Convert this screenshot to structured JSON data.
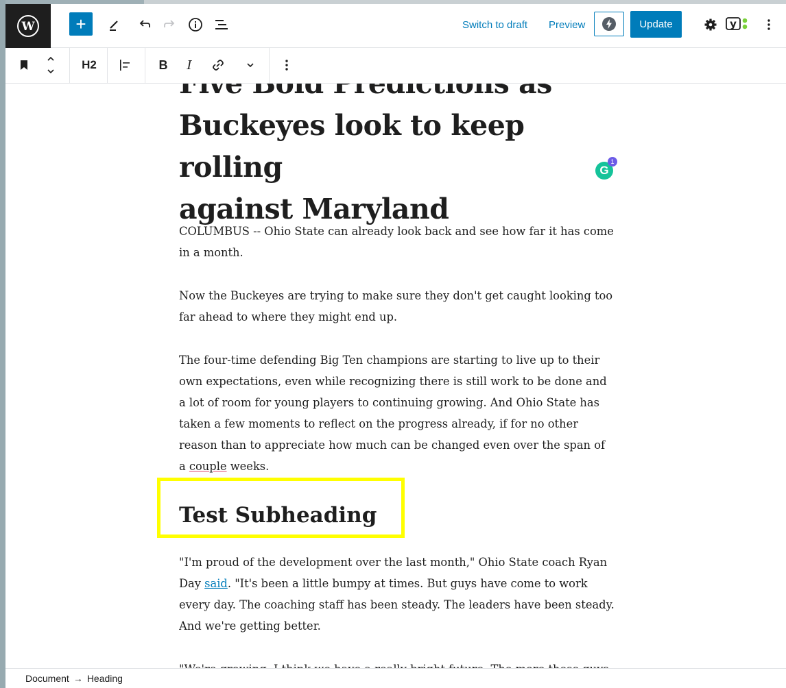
{
  "header": {
    "switch_to_draft": "Switch to draft",
    "preview": "Preview",
    "update": "Update"
  },
  "block_toolbar": {
    "block_type": "H2",
    "bold": "B",
    "italic": "I"
  },
  "post": {
    "title_line1": "Five Bold Predictions as",
    "title_line2": "Buckeyes look to keep rolling",
    "title_line3": "against Maryland",
    "para1_line1": "COLUMBUS -- Ohio State can already look back and see how far it has come",
    "para1_line2": "in a month.",
    "para2_line1": "Now the Buckeyes are trying to make sure they don't get caught looking too",
    "para2_line2": "far ahead to where they might end up.",
    "para3_line1": "The four-time defending Big Ten champions are starting to live up to their",
    "para3_line2": "own expectations, even while recognizing there is still work to be done and",
    "para3_line3": "a lot of room for young players to continuing growing. And Ohio State has",
    "para3_line4": "taken a few moments to reflect on the progress already, if for no other",
    "para3_line5": "reason than to appreciate how much can be changed even over the span of",
    "para3_line6_a": "a ",
    "para3_line6_b": "couple",
    "para3_line6_c": " weeks.",
    "subheading": "Test Subheading",
    "para4_line1": "\"I'm proud of the development over the last month,\" Ohio State coach Ryan",
    "para4_line2_a": "Day ",
    "para4_line2_link": "said",
    "para4_line2_b": ". \"It's been a little bumpy at times. But guys have come to work",
    "para4_line3": "every day. The coaching staff has been steady. The leaders have been steady.",
    "para4_line4": "And we're getting better.",
    "para5_line1": "\"We're growing. I think we have a really bright future. The more these guys"
  },
  "grammarly": {
    "count": "1",
    "letter": "G"
  },
  "breadcrumb": {
    "document": "Document",
    "arrow": "→",
    "heading": "Heading"
  },
  "colors": {
    "accent": "#007cba",
    "highlight": "#ffff00",
    "grammarly": "#15c39a"
  }
}
